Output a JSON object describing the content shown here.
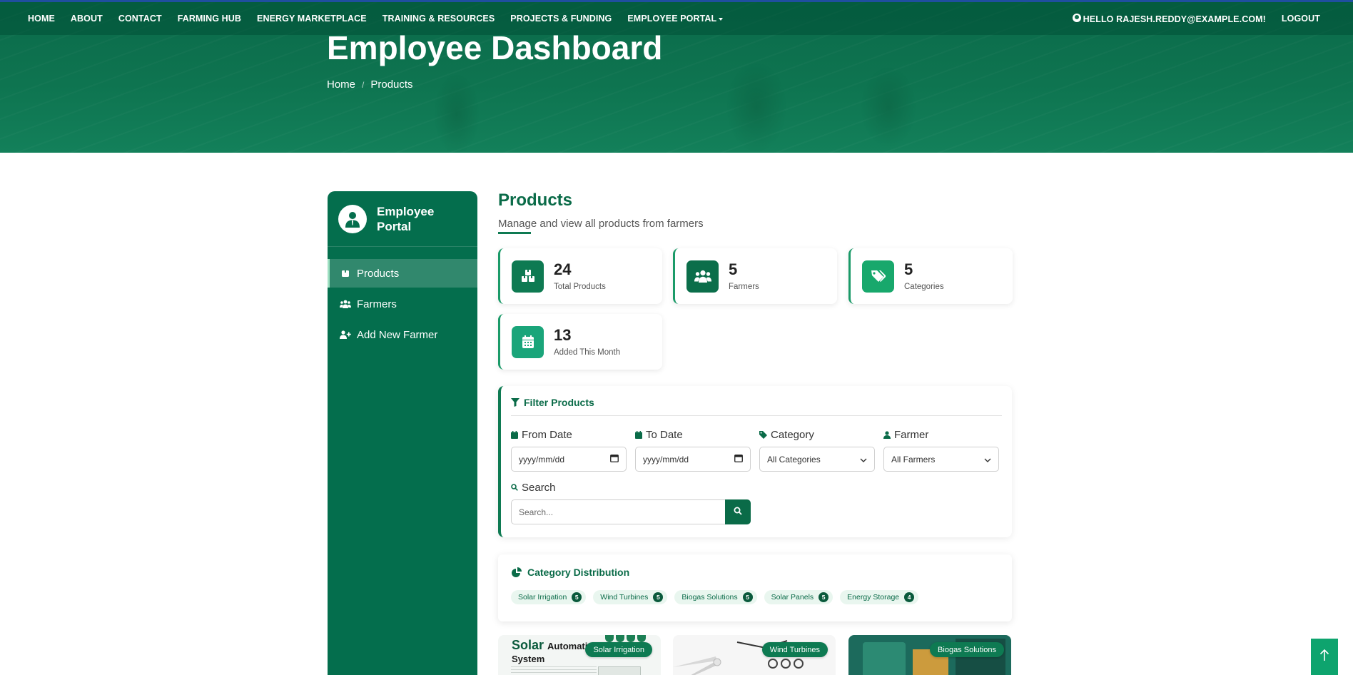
{
  "nav": {
    "items": [
      "HOME",
      "ABOUT",
      "CONTACT",
      "FARMING HUB",
      "ENERGY MARKETPLACE",
      "TRAINING & RESOURCES",
      "PROJECTS & FUNDING",
      "EMPLOYEE PORTAL"
    ],
    "greeting": "HELLO RAJESH.REDDY@EXAMPLE.COM!",
    "logout": "LOGOUT"
  },
  "hero": {
    "title": "Employee Dashboard",
    "breadcrumb": [
      "Home",
      "Products"
    ],
    "separator": "/"
  },
  "sidebar": {
    "title": "Employee Portal",
    "items": [
      {
        "label": "Products",
        "icon": "box-icon",
        "active": true
      },
      {
        "label": "Farmers",
        "icon": "users-icon",
        "active": false
      },
      {
        "label": "Add New Farmer",
        "icon": "user-plus-icon",
        "active": false
      }
    ]
  },
  "main": {
    "title": "Products",
    "subtitle": "Manage and view all products from farmers"
  },
  "stats": [
    {
      "value": "24",
      "label": "Total Products",
      "icon": "boxes-icon",
      "color": "#0e7a52"
    },
    {
      "value": "5",
      "label": "Farmers",
      "icon": "users-icon",
      "color": "#0b6e4a"
    },
    {
      "value": "5",
      "label": "Categories",
      "icon": "tags-icon",
      "color": "#18a86c"
    },
    {
      "value": "13",
      "label": "Added This Month",
      "icon": "calendar-icon",
      "color": "#1aa57a"
    }
  ],
  "filter": {
    "title": "Filter Products",
    "from_label": "From Date",
    "from_value": "yyyy/mm/dd",
    "to_label": "To Date",
    "to_value": "yyyy/mm/dd",
    "category_label": "Category",
    "category_value": "All Categories",
    "farmer_label": "Farmer",
    "farmer_value": "All Farmers",
    "search_label": "Search",
    "search_placeholder": "Search..."
  },
  "category_distribution": {
    "title": "Category Distribution",
    "chips": [
      {
        "name": "Solar Irrigation",
        "count": "5"
      },
      {
        "name": "Wind Turbines",
        "count": "5"
      },
      {
        "name": "Biogas Solutions",
        "count": "5"
      },
      {
        "name": "Solar Panels",
        "count": "5"
      },
      {
        "name": "Energy Storage",
        "count": "4"
      }
    ]
  },
  "product_cards": [
    {
      "badge": "Solar Irrigation",
      "image_text_main": "Solar",
      "image_text_sub": "Automatic Watering System"
    },
    {
      "badge": "Wind Turbines"
    },
    {
      "badge": "Biogas Solutions"
    }
  ],
  "colors": {
    "primary": "#0a6b48",
    "sidebar": "#046e4d",
    "accent": "#0ea46e"
  }
}
